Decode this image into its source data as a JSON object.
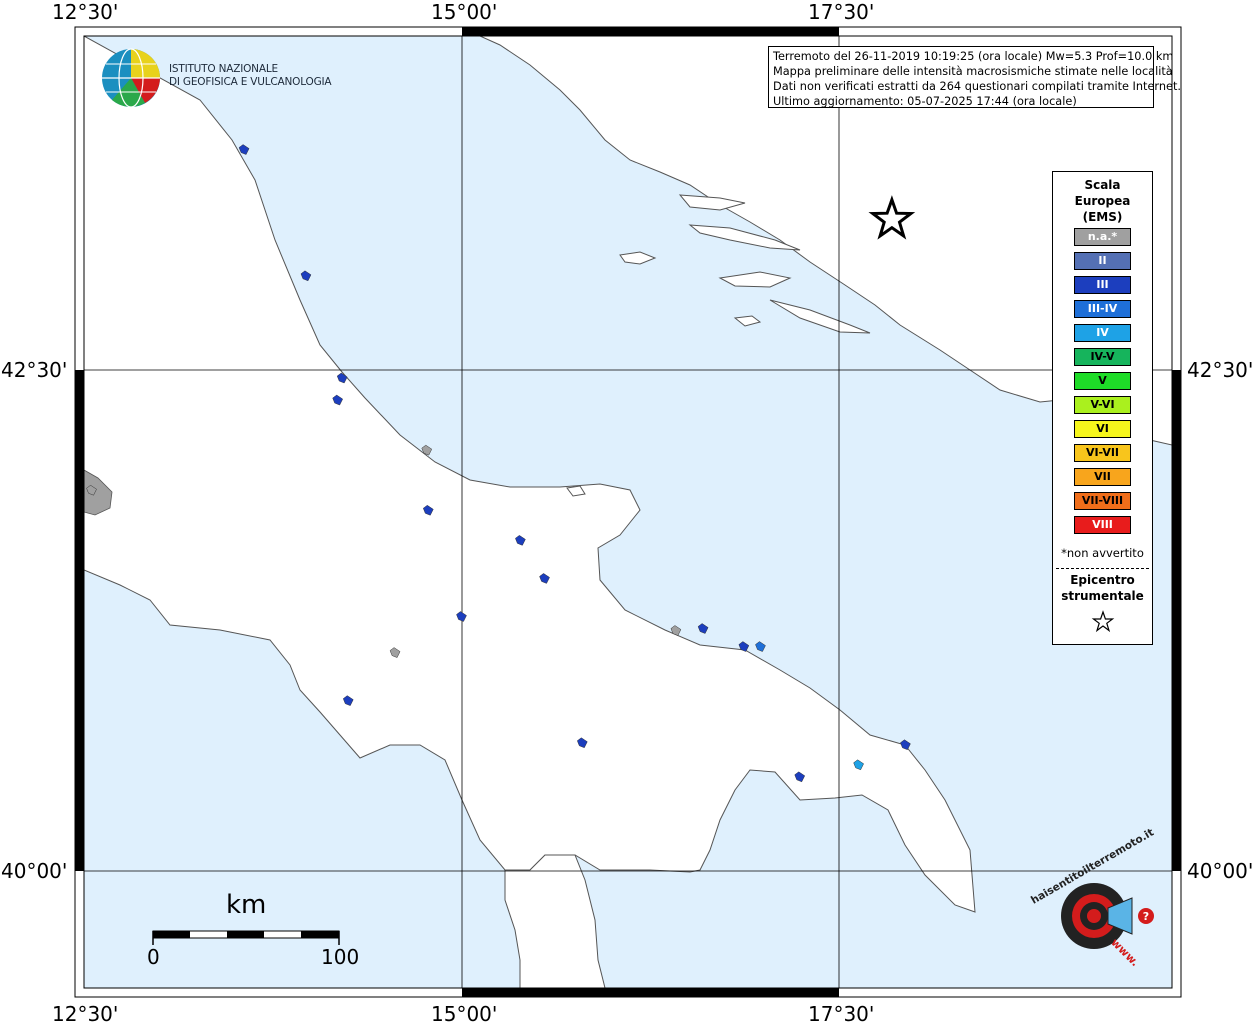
{
  "map": {
    "info_lines": [
      "Terremoto del 26-11-2019 10:19:25 (ora locale) Mw=5.3 Prof=10.0 km",
      "Mappa preliminare delle intensità macrosismiche stimate nelle località",
      "Dati non verificati estratti da 264 questionari compilati tramite Internet.",
      "Ultimo aggiornamento: 05-07-2025 17:44 (ora locale)"
    ],
    "ticks": {
      "top": [
        "12°30'",
        "15°00'",
        "17°30'"
      ],
      "bottom": [
        "12°30'",
        "15°00'",
        "17°30'"
      ],
      "left": [
        "42°30'",
        "40°00'"
      ],
      "right": [
        "42°30'",
        "40°00'"
      ]
    },
    "sea_color": "#dff0fd",
    "land_color": "#ffffff"
  },
  "ingv": {
    "line1": "ISTITUTO NAZIONALE",
    "line2": "DI GEOFISICA E VULCANOLOGIA"
  },
  "legend": {
    "title": [
      "Scala",
      "Europea",
      "(EMS)"
    ],
    "items": [
      {
        "label": "n.a.*",
        "color": "#a0a0a0",
        "text": "#ffffff"
      },
      {
        "label": "II",
        "color": "#5470b4",
        "text": "#ffffff"
      },
      {
        "label": "III",
        "color": "#1c3ebe",
        "text": "#ffffff"
      },
      {
        "label": "III-IV",
        "color": "#1e6fd8",
        "text": "#ffffff"
      },
      {
        "label": "IV",
        "color": "#1ea2e6",
        "text": "#ffffff"
      },
      {
        "label": "IV-V",
        "color": "#16b45c",
        "text": "#000000"
      },
      {
        "label": "V",
        "color": "#1edc28",
        "text": "#000000"
      },
      {
        "label": "V-VI",
        "color": "#aaf01e",
        "text": "#000000"
      },
      {
        "label": "VI",
        "color": "#f6f61c",
        "text": "#000000"
      },
      {
        "label": "VI-VII",
        "color": "#f8c51c",
        "text": "#000000"
      },
      {
        "label": "VII",
        "color": "#f8a51c",
        "text": "#000000"
      },
      {
        "label": "VII-VIII",
        "color": "#f06e1a",
        "text": "#000000"
      },
      {
        "label": "VIII",
        "color": "#e81c1c",
        "text": "#ffffff"
      }
    ],
    "note": "*non avvertito",
    "epicenter_label": [
      "Epicentro",
      "strumentale"
    ]
  },
  "scale_bar": {
    "unit": "km",
    "min": "0",
    "max": "100"
  },
  "haisentito": {
    "text": "haisentitoilterremoto.it",
    "url": "www.",
    "q": "?"
  },
  "epicenter": {
    "lon": 17.85,
    "lat": 43.25,
    "icon": "star-icon"
  },
  "points": [
    {
      "lon": 13.56,
      "lat": 43.6,
      "cls": "III"
    },
    {
      "lon": 13.97,
      "lat": 42.97,
      "cls": "III"
    },
    {
      "lon": 14.21,
      "lat": 42.46,
      "cls": "III"
    },
    {
      "lon": 14.18,
      "lat": 42.35,
      "cls": "III"
    },
    {
      "lon": 14.78,
      "lat": 41.8,
      "cls": "III"
    },
    {
      "lon": 15.55,
      "lat": 41.46,
      "cls": "III"
    },
    {
      "lon": 15.39,
      "lat": 41.65,
      "cls": "III"
    },
    {
      "lon": 14.25,
      "lat": 40.85,
      "cls": "III"
    },
    {
      "lon": 15.0,
      "lat": 41.27,
      "cls": "III"
    },
    {
      "lon": 15.8,
      "lat": 40.64,
      "cls": "III"
    },
    {
      "lon": 16.87,
      "lat": 41.12,
      "cls": "III"
    },
    {
      "lon": 17.24,
      "lat": 40.47,
      "cls": "III"
    },
    {
      "lon": 17.94,
      "lat": 40.63,
      "cls": "III"
    },
    {
      "lon": 16.6,
      "lat": 41.21,
      "cls": "III"
    },
    {
      "lon": 16.98,
      "lat": 41.12,
      "cls": "III-IV"
    },
    {
      "lon": 17.63,
      "lat": 40.53,
      "cls": "IV"
    },
    {
      "lon": 14.77,
      "lat": 42.1,
      "cls": "n.a."
    },
    {
      "lon": 16.42,
      "lat": 41.2,
      "cls": "n.a."
    },
    {
      "lon": 14.56,
      "lat": 41.09,
      "cls": "n.a."
    },
    {
      "lon": 12.55,
      "lat": 41.9,
      "cls": "n.a."
    }
  ]
}
